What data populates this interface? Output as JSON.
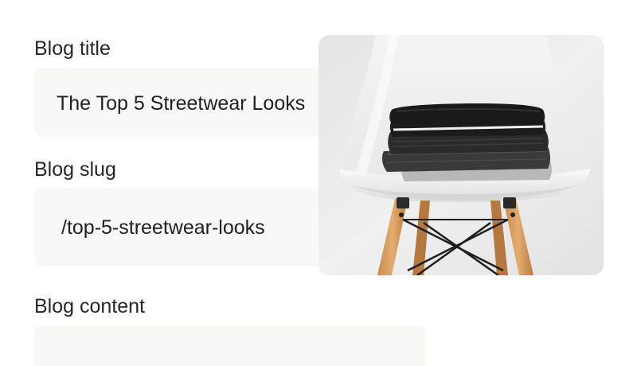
{
  "form": {
    "title_field": {
      "label": "Blog title",
      "value": "The Top 5 Streetwear Looks"
    },
    "slug_field": {
      "label": "Blog slug",
      "value": "/top-5-streetwear-looks"
    },
    "content_field": {
      "label": "Blog content",
      "value": ""
    }
  },
  "image": {
    "subject": "folded clothes stacked on white chair"
  },
  "colors": {
    "field_background": "#f8f8f5",
    "text": "#262626",
    "photo_background": "#ebebeb"
  }
}
